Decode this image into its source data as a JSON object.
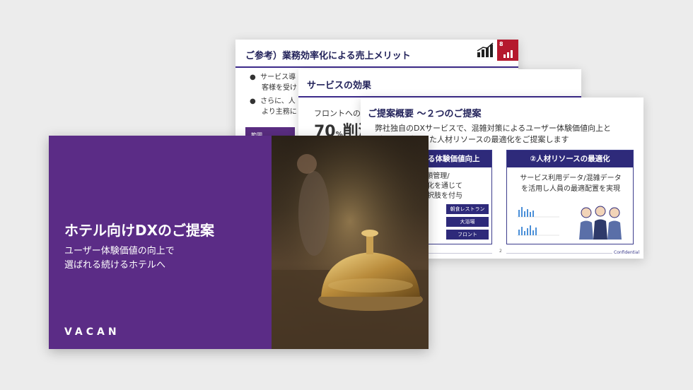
{
  "slide_back": {
    "title": "ご参考）業務効率化による売上メリット",
    "bullet1_line1": "サービス導",
    "bullet1_line2": "客様を受け",
    "bullet2_line1": "さらに、人",
    "bullet2_line2": "より主務に",
    "tag": "範囲",
    "sdg_number": "8",
    "sdg_color": "#b5192e"
  },
  "slide_middle": {
    "title": "サービスの効果",
    "front_text": "フロントへの",
    "percent_value": "70",
    "percent_unit": "%",
    "percent_label": "削減"
  },
  "slide_front": {
    "title": "ご提案概要 ～２つのご提案",
    "desc_line1": "弊社独自のDXサービスで、混雑対策によるユーザー体験価値向上と",
    "desc_line2": "データを活用した人材リソースの最適化をご提案します",
    "col1": {
      "header": "①混雑対策による体験価値向上",
      "line1": "待ち順管理/",
      "line2": "混雑可視化を通じて",
      "line3": "行動に選択肢を付与",
      "pills": [
        "朝食レストラン",
        "大浴場",
        "フロント"
      ]
    },
    "col2": {
      "header": "②人材リソースの最適化",
      "line1": "サービス利用データ/混雑データ",
      "line2": "を活用し人員の最適配置を実現"
    },
    "page_number": "2",
    "confidential": "Confidential"
  },
  "title_slide": {
    "title": "ホテル向けDXのご提案",
    "subtitle_line1": "ユーザー体験価値の向上で",
    "subtitle_line2": "選ばれる続けるホテルへ",
    "logo": "VACAN",
    "brand_color": "#5b2c86"
  }
}
